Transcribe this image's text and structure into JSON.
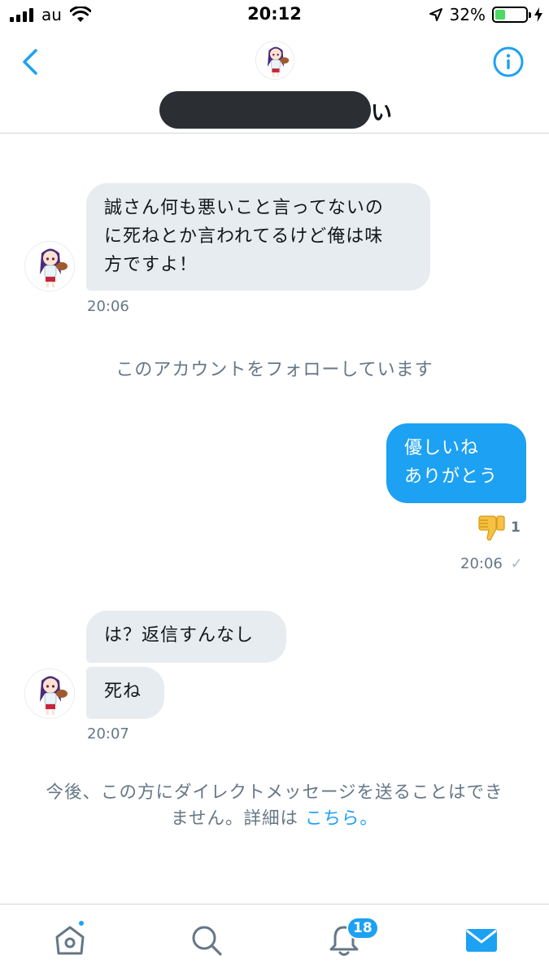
{
  "status_bar": {
    "carrier": "au",
    "time": "20:12",
    "battery_percent": "32%",
    "battery_level": 0.32,
    "icons": [
      "signal-icon",
      "wifi-icon",
      "location-arrow-icon",
      "battery-icon",
      "charging-bolt-icon"
    ]
  },
  "header": {
    "name_visible_suffix": "い",
    "name_redacted": true,
    "icons": [
      "back-chevron-icon",
      "info-icon"
    ]
  },
  "messages": [
    {
      "direction": "incoming",
      "text_lines": [
        "誠さん何も悪いこと言ってないの",
        "に死ねとか言われてるけど俺は味",
        "方ですよ！"
      ],
      "time": "20:06"
    },
    {
      "direction": "outgoing",
      "text_lines": [
        "優しいね",
        "ありがとう"
      ],
      "time": "20:06",
      "reaction": {
        "icon": "thumbs-down-emoji",
        "count": "1"
      },
      "status": "✓"
    },
    {
      "direction": "incoming",
      "text": "は？返信すんなし"
    },
    {
      "direction": "incoming",
      "text": "死ね",
      "time": "20:07"
    }
  ],
  "system": {
    "following_notice": "このアカウントをフォローしています"
  },
  "dm_blocked_notice": {
    "line1": "今後、この方にダイレクトメッセージを送ることはでき",
    "line2_text": "ません。詳細は",
    "link": "こちら。"
  },
  "tab_bar": {
    "tabs": [
      "home-icon",
      "search-icon",
      "notifications-icon",
      "messages-icon"
    ],
    "notifications_badge": "18",
    "accent_color": "#1da1f2"
  },
  "colors": {
    "accent": "#1da1f2",
    "incoming_bubble": "#e6ecf0",
    "secondary_text": "#657786"
  }
}
